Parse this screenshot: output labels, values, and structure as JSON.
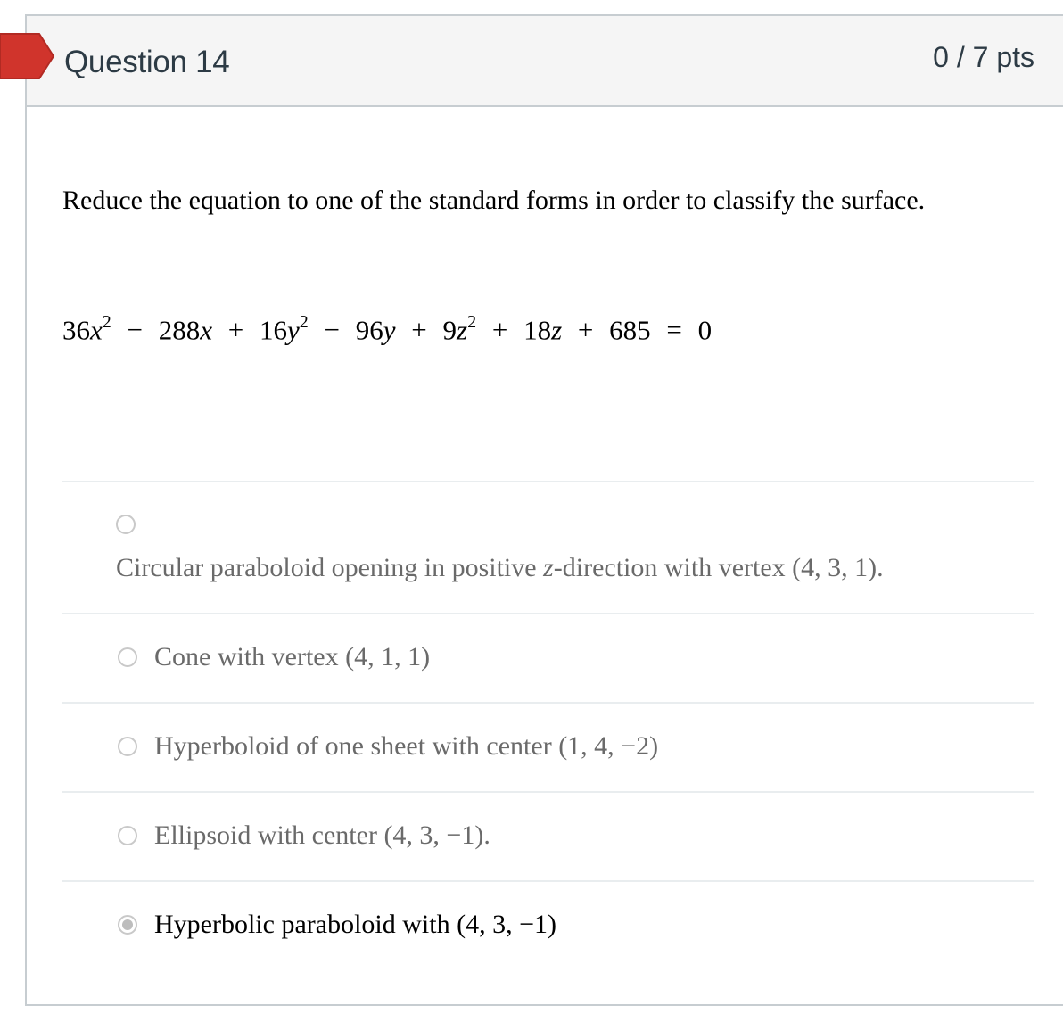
{
  "header": {
    "title": "Question 14",
    "points": "0 / 7 pts"
  },
  "question": {
    "prompt": "Reduce the equation to one of the standard forms in order to classify the surface.",
    "equation": {
      "t1": "36",
      "v1": "x",
      "e1": "2",
      "op1": "−",
      "t2": "288",
      "v2": "x",
      "op2": "+",
      "t3": "16",
      "v3": "y",
      "e3": "2",
      "op3": "−",
      "t4": "96",
      "v4": "y",
      "op4": "+",
      "t5": "9",
      "v5": "z",
      "e5": "2",
      "op5": "+",
      "t6": "18",
      "v6": "z",
      "op6": "+",
      "t7": "685",
      "op7": "=",
      "t8": "0"
    }
  },
  "answers": [
    {
      "pre": "Circular paraboloid opening in positive ",
      "var": "z",
      "post": "-direction with vertex (4,  3,  1).",
      "selected": false
    },
    {
      "pre": "Cone with vertex (4,  1,  1)",
      "selected": false
    },
    {
      "pre": "Hyperboloid of one sheet with center (1,  4,  −2)",
      "selected": false
    },
    {
      "pre": "Ellipsoid with center (4,  3,  −1).",
      "selected": false
    },
    {
      "pre": "Hyperbolic paraboloid with (4,  3,  −1)",
      "selected": true
    }
  ],
  "colors": {
    "flag": "#d0342c",
    "title": "#2d3b45",
    "unselected_text": "#6a6a6a",
    "selected_text": "#000000",
    "divider": "#e9edef"
  },
  "icons": {
    "flag": "bookmark-flag-icon",
    "radio": "radio-button-icon"
  }
}
